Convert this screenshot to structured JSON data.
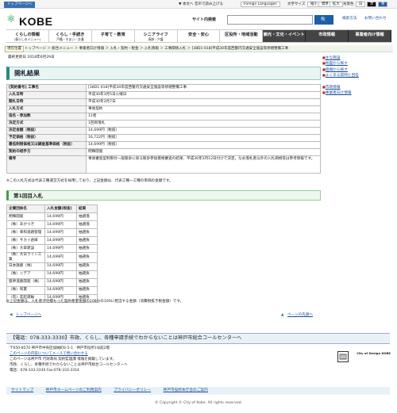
{
  "topbar": {
    "skip": "トップページへ",
    "fontsize": "▼ 本文へ",
    "read": "音声で読み上げる",
    "lang": "Foreign Languages",
    "charsize": "文字サイズ",
    "small": "縮小",
    "std": "標準",
    "large": "拡大",
    "bg": "背景色",
    "white": "白",
    "black": "黒",
    "blue": "青"
  },
  "header": {
    "logo_mark": "⚛",
    "logo": "KOBE",
    "search_label": "サイト内検索",
    "search_placeholder": "",
    "search_btn": "🔍",
    "link1": "検索方法",
    "link2": "お問い合わせ"
  },
  "gnav": [
    {
      "label": "くらしの情報",
      "sub": "(暮らしのメニュー)"
    },
    {
      "label": "くらし・手続き",
      "sub": "戸籍・すまい・交通"
    },
    {
      "label": "子育て・教育",
      "sub": ""
    },
    {
      "label": "シニアライフ",
      "sub": "高齢・介護"
    },
    {
      "label": "安全・安心",
      "sub": ""
    },
    {
      "label": "区役所・地域活動",
      "sub": ""
    },
    {
      "label": "観光・文化・イベント",
      "sub": ""
    },
    {
      "label": "市政情報",
      "sub": ""
    },
    {
      "label": "事業者向け情報",
      "sub": ""
    }
  ],
  "breadcrumb": {
    "label": "現在位置",
    "items": "トップページ ＞ 総合メニュー ＞ 事業者向け情報 ＞ 入札・契約・税金 ＞ 入札情報 ＞ 工事関係入札 ＞ [38D1-018]平成30年度西警内交通安全施設等修繕整備工事"
  },
  "updated": "最終更新日 2018年6月29日",
  "title": "開札結果",
  "info": [
    {
      "k": "[契約番号] 工事名",
      "v": "[38D1-018]平成30年度西警内交通安全施設等修繕整備工事"
    },
    {
      "k": "入札日時",
      "v": "平成30年3月5日火曜日"
    },
    {
      "k": "開札日時",
      "v": "平成30年3月7日"
    },
    {
      "k": "入札方式",
      "v": "事後契約"
    },
    {
      "k": "指名・参加数",
      "v": "11者"
    },
    {
      "k": "決定方式",
      "v": "1回目落札"
    },
    {
      "k": "決定金額（税抜）",
      "v": "14,699円（税抜）"
    },
    {
      "k": "予定価格（税抜）",
      "v": "16,722円（税抜）"
    },
    {
      "k": "最低制限価格又は調査基準価格（税抜）",
      "v": "14,699円（税抜）"
    },
    {
      "k": "契約の相手方",
      "v": "明輝開発"
    },
    {
      "k": "備考",
      "v": "事後審査型制限付一般競争に係る競争参加資格審査の結果、平成30年3月12日付けで決定。なお落札者以外の入札価格等は参考情報です。"
    }
  ],
  "note1": "※この入札方式は代表工種運営方式を採用しており、上記金額は、代表工種一工種の単価の金額です。",
  "round_title": "第1回目入札",
  "bid_headers": [
    "企業団体名",
    "入札金額(税抜)",
    "結果"
  ],
  "bids": [
    [
      "明輝開発",
      "14,699円",
      "抽選落"
    ],
    [
      "（株）あかつき",
      "14,699円",
      "抽選落"
    ],
    [
      "（株）幸和道路管理",
      "14,699円",
      "抽選負"
    ],
    [
      "（株）サカイ倉庫",
      "14,699円",
      "抽選負"
    ],
    [
      "（株）大翠建設",
      "14,699円",
      "抽選負"
    ],
    [
      "（株）大日ライン工業",
      "14,699円",
      "抽選負"
    ],
    [
      "日本鉄路（株）",
      "14,699円",
      "抽選負"
    ],
    [
      "（株）ニデア",
      "14,699円",
      "抽選負"
    ],
    [
      "阪神道路開発（株）",
      "14,699円",
      "抽選負"
    ],
    [
      "（株）和憲",
      "14,699円",
      "抽選負"
    ],
    [
      "（有）友起運輸",
      "14,699円",
      "抽選負"
    ]
  ],
  "note2": "※上記金額は、入札者が見積もった契約希望金額の108分の100に相当する金額（消費税抜き税金額）です。",
  "pagelinks": {
    "top": "トップページへ",
    "pagetop": "ページの先頭へ"
  },
  "side": [
    "主な施設",
    "地図から探す",
    "組織から探す",
    "よくある質問と回答",
    "",
    "市政情報",
    "事業者向け情報"
  ],
  "callbar": "【電話：078-333-3330】市政、くらし、各種申請手続でわからないことは神戸市総合コールセンターへ",
  "addr": [
    "〒650-8570 神戸市中央区加納町6-5-1　神戸市役所1号館2階",
    "このページの内容についてメールで問い合わせる",
    "このページは神戸市 行財政局 契約監理課 情報を掲載しています。",
    "市政、くらし、各種手続でわからないことは神戸市総合コールセンターへ",
    "電話：078-333-3330 Fax:078-333-3314"
  ],
  "kobe_logo": {
    "text": "City of Design KOBE",
    "unesco": "UNESCO"
  },
  "foot_links": [
    "サイトマップ",
    "神戸市ホームページのご利用案内",
    "プライバシーポリシー",
    "神戸市役所本庁舎のご案内"
  ],
  "copyright": "© Copyright © City of Kobe. All rights reserved."
}
